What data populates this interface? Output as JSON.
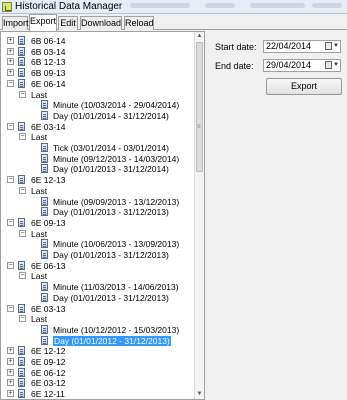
{
  "window": {
    "title": "Historical Data Manager"
  },
  "tabs": [
    "Import",
    "Export",
    "Edit",
    "Download",
    "Reload"
  ],
  "active_tab": "Export",
  "tree": [
    {
      "label": "6B 06-14",
      "expanded": false
    },
    {
      "label": "6B 03-14",
      "expanded": false
    },
    {
      "label": "6B 12-13",
      "expanded": false
    },
    {
      "label": "6B 09-13",
      "expanded": false
    },
    {
      "label": "6E 06-14",
      "expanded": true,
      "children": [
        {
          "label": "Last",
          "children": [
            "Minute (10/03/2014 - 29/04/2014)",
            "Day (01/01/2014 - 31/12/2014)"
          ]
        }
      ]
    },
    {
      "label": "6E 03-14",
      "expanded": true,
      "children": [
        {
          "label": "Last",
          "children": [
            "Tick (03/01/2014 - 03/01/2014)",
            "Minute (09/12/2013 - 14/03/2014)",
            "Day (01/01/2013 - 31/12/2014)"
          ]
        }
      ]
    },
    {
      "label": "6E 12-13",
      "expanded": true,
      "children": [
        {
          "label": "Last",
          "children": [
            "Minute (09/09/2013 - 13/12/2013)",
            "Day (01/01/2013 - 31/12/2013)"
          ]
        }
      ]
    },
    {
      "label": "6E 09-13",
      "expanded": true,
      "children": [
        {
          "label": "Last",
          "children": [
            "Minute (10/06/2013 - 13/09/2013)",
            "Day (01/01/2013 - 31/12/2013)"
          ]
        }
      ]
    },
    {
      "label": "6E 06-13",
      "expanded": true,
      "children": [
        {
          "label": "Last",
          "children": [
            "Minute (11/03/2013 - 14/06/2013)",
            "Day (01/01/2013 - 31/12/2013)"
          ]
        }
      ]
    },
    {
      "label": "6E 03-13",
      "expanded": true,
      "children": [
        {
          "label": "Last",
          "children": [
            "Minute (10/12/2012 - 15/03/2013)",
            "Day (01/01/2012 - 31/12/2013)"
          ]
        }
      ]
    },
    {
      "label": "6E 12-12",
      "expanded": false
    },
    {
      "label": "6E 09-12",
      "expanded": false
    },
    {
      "label": "6E 06-12",
      "expanded": false
    },
    {
      "label": "6E 03-12",
      "expanded": false
    },
    {
      "label": "6E 12-11",
      "expanded": false
    },
    {
      "label": "6E 09-11",
      "expanded": false
    }
  ],
  "selected_item": "Day (01/01/2012 - 31/12/2013)",
  "form": {
    "start_label": "Start date:",
    "start_value": "22/04/2014",
    "end_label": "End date:",
    "end_value": "29/04/2014",
    "export_label": "Export"
  },
  "colors": {
    "selection": "#3399ff",
    "titlebar": "#e6edf6"
  }
}
